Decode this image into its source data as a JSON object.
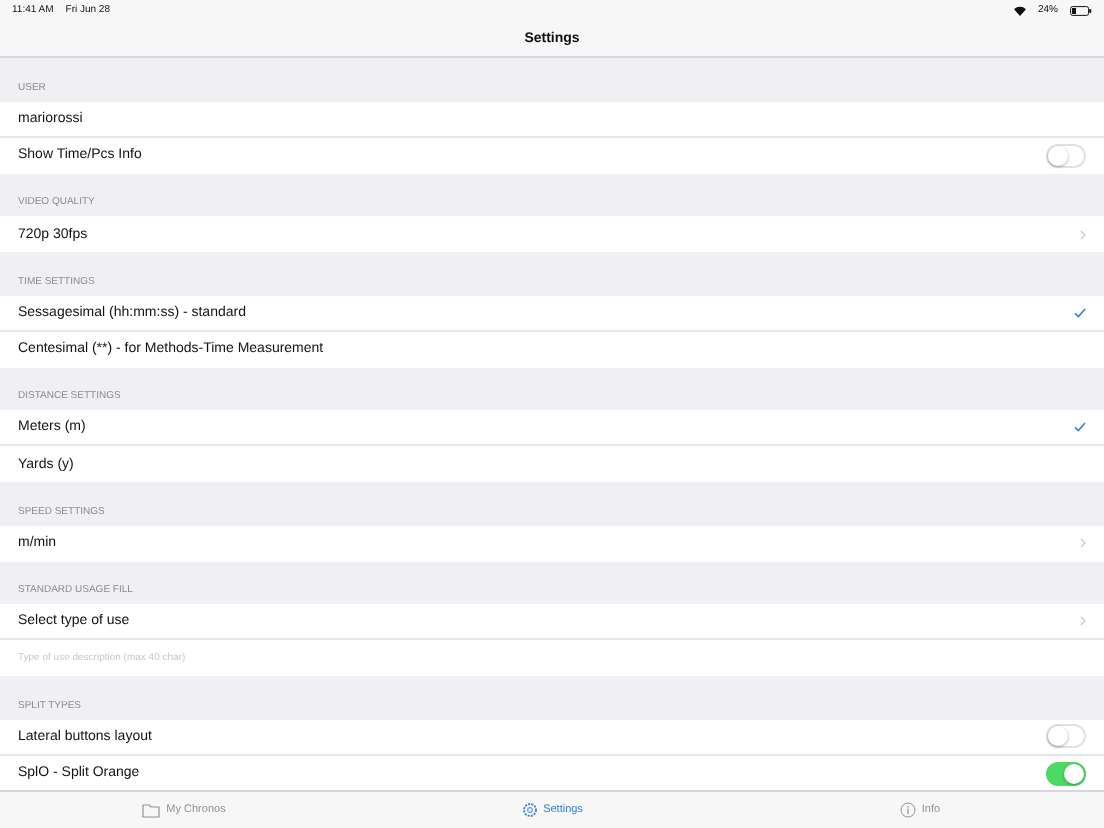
{
  "status_bar": {
    "time": "11:41 AM",
    "date": "Fri Jun 28",
    "battery": "24%"
  },
  "nav_bar": {
    "title": "Settings"
  },
  "sections": [
    {
      "header": "USER",
      "items": [
        {
          "kind": "text",
          "label": "mariorossi"
        },
        {
          "kind": "toggle",
          "label": "Show Time/Pcs Info",
          "on": false
        }
      ]
    },
    {
      "header": "VIDEO QUALITY",
      "items": [
        {
          "kind": "chevron",
          "label": "720p 30fps"
        }
      ]
    },
    {
      "header": "TIME SETTINGS",
      "items": [
        {
          "kind": "check",
          "label": "Sessagesimal (hh:mm:ss) - standard",
          "checked": true
        },
        {
          "kind": "check",
          "label": "Centesimal (**) - for Methods-Time Measurement",
          "checked": false
        }
      ]
    },
    {
      "header": "DISTANCE SETTINGS",
      "items": [
        {
          "kind": "check",
          "label": "Meters (m)",
          "checked": true
        },
        {
          "kind": "check",
          "label": "Yards (y)",
          "checked": false
        }
      ]
    },
    {
      "header": "SPEED SETTINGS",
      "items": [
        {
          "kind": "chevron",
          "label": "m/min"
        }
      ]
    },
    {
      "header": "STANDARD USAGE FILL",
      "items": [
        {
          "kind": "chevron",
          "label": "Select type of use"
        },
        {
          "kind": "field",
          "placeholder": "Type of use description (max 40 char)"
        }
      ]
    },
    {
      "header": "SPLIT TYPES",
      "items": [
        {
          "kind": "toggle",
          "label": "Lateral buttons layout",
          "on": false
        },
        {
          "kind": "toggle",
          "label": "SplO - Split Orange",
          "on": true
        }
      ]
    }
  ],
  "tab_bar": [
    {
      "label": "My Chronos",
      "selected": false
    },
    {
      "label": "Settings",
      "selected": true
    },
    {
      "label": "Info",
      "selected": false
    }
  ]
}
